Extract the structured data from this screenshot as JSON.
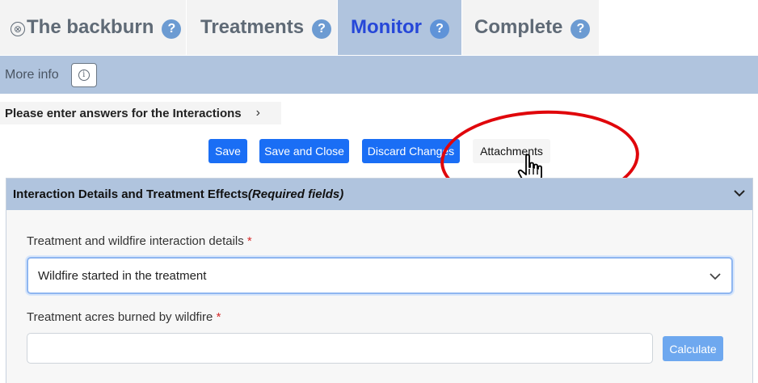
{
  "tabs": [
    {
      "label": "The backburn",
      "help": "?",
      "close": "⊗"
    },
    {
      "label": "Treatments",
      "help": "?"
    },
    {
      "label": "Monitor",
      "help": "?"
    },
    {
      "label": "Complete",
      "help": "?"
    }
  ],
  "active_tab": "Monitor",
  "info_bar": {
    "label": "More info",
    "info_icon": "i"
  },
  "prompt": {
    "text": "Please enter answers for the Interactions",
    "chevron": "›"
  },
  "actions": {
    "save": "Save",
    "save_close": "Save and Close",
    "discard": "Discard Changes",
    "attachments": "Attachments"
  },
  "panel": {
    "title": "Interaction Details and Treatment Effects",
    "title_suffix": "(Required fields)"
  },
  "fields": {
    "interaction_label": "Treatment and wildfire interaction details",
    "interaction_value": "Wildfire started in the treatment",
    "acres_label": "Treatment acres burned by wildfire",
    "acres_value": "",
    "required_marker": "*",
    "calculate": "Calculate"
  },
  "colors": {
    "accent_blue": "#1a6ef5",
    "tab_active_bg": "#b0c4de",
    "annotation_red": "#e0060b"
  }
}
